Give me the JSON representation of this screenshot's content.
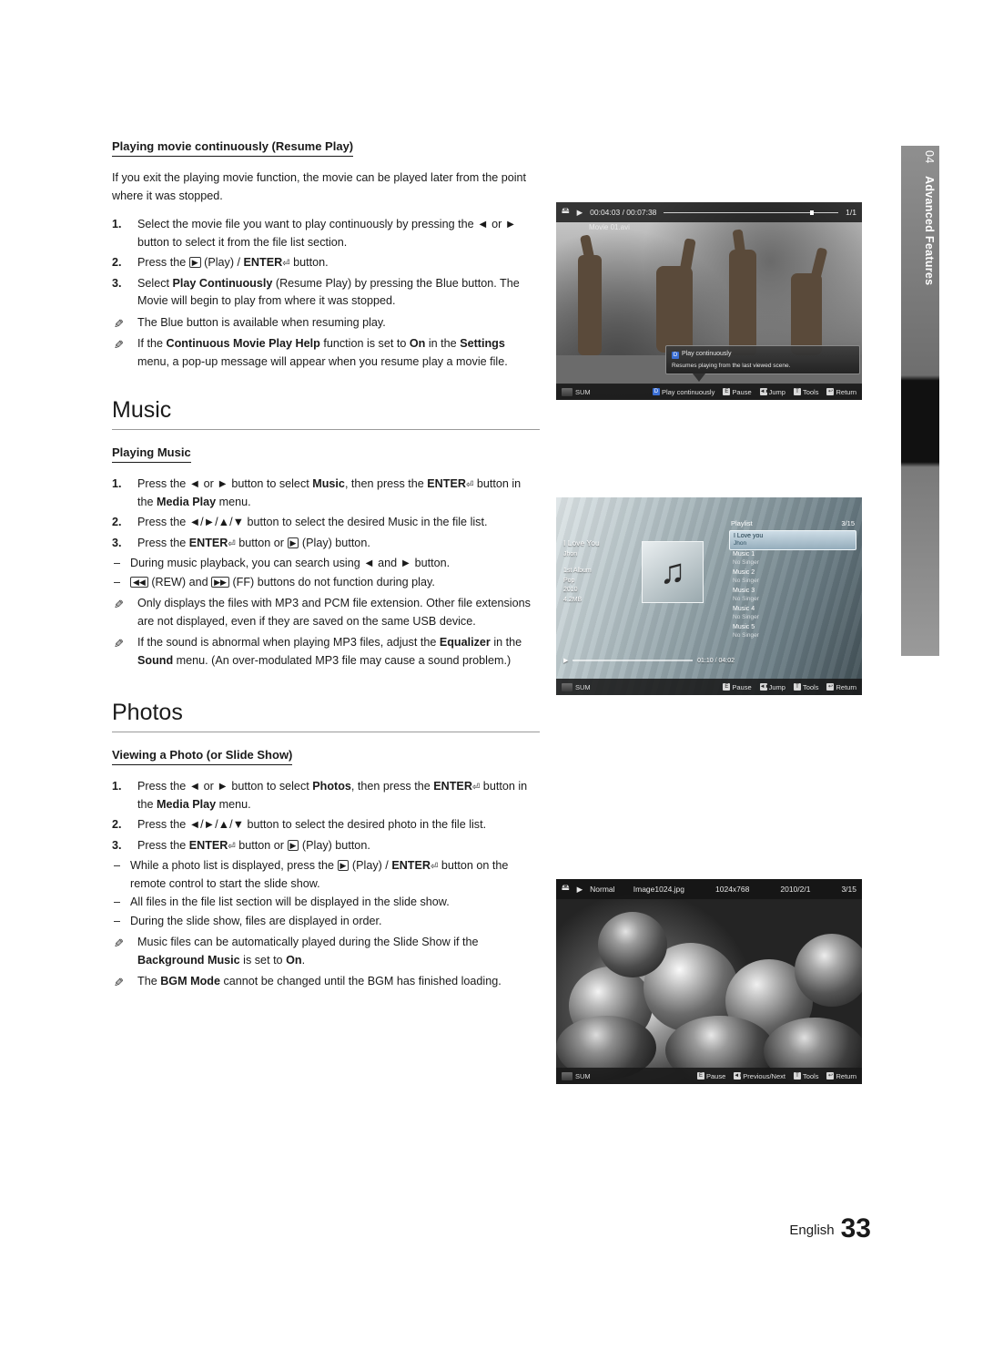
{
  "side_tab": {
    "number": "04",
    "title": "Advanced Features"
  },
  "sections": {
    "resume_play": {
      "heading": "Playing movie continuously (Resume Play)",
      "intro": "If you exit the playing movie function, the movie can be played later from the point where it was stopped.",
      "steps": [
        {
          "num": "1.",
          "text_a": "Select the movie file you want to play continuously by pressing the ",
          "text_b": " or ",
          "text_c": " button to select it from the file list section."
        },
        {
          "num": "2.",
          "text": "Press the  (Play) / ENTER button."
        },
        {
          "num": "3.",
          "text": "Select Play Continuously (Resume Play) by pressing the Blue button. The Movie will begin to play from where it was stopped."
        }
      ],
      "notes": [
        "The Blue button is available when resuming play.",
        "If the Continuous Movie Play Help function is set to On in the Settings menu, a pop-up message will appear when you resume play a movie file."
      ]
    },
    "music": {
      "chapter": "Music",
      "heading": "Playing Music",
      "steps": [
        {
          "num": "1.",
          "text": "Press the ◄ or ► button to select Music, then press the ENTER button in the Media Play menu."
        },
        {
          "num": "2.",
          "text": "Press the ◄/►/▲/▼ button to select the desired Music in the file list."
        },
        {
          "num": "3.",
          "text": "Press the ENTER button or  (Play) button."
        }
      ],
      "dashes": [
        "During music playback, you can search using ◄ and ► button.",
        "(REW) and (FF) buttons do not function during play."
      ],
      "notes": [
        "Only displays the files with MP3 and PCM file extension. Other file extensions are not displayed, even if they are saved on the same USB device.",
        "If the sound is abnormal when playing MP3 files, adjust the Equalizer in the Sound menu. (An over-modulated MP3 file may cause a sound problem.)"
      ]
    },
    "photos": {
      "chapter": "Photos",
      "heading": "Viewing a Photo (or Slide Show)",
      "steps": [
        {
          "num": "1.",
          "text": "Press the ◄ or ► button to select Photos, then press the ENTER button in the Media Play menu."
        },
        {
          "num": "2.",
          "text": "Press the ◄/►/▲/▼ button to select the desired photo in the file list."
        },
        {
          "num": "3.",
          "text": "Press the ENTER button or  (Play) button."
        }
      ],
      "dashes": [
        "While a photo list is displayed, press the  (Play) / ENTER button on the remote control to start the slide show.",
        "All files in the file list section will be displayed in the slide show.",
        "During the slide show, files are displayed in order."
      ],
      "notes": [
        "Music files can be automatically played during the Slide Show if the Background Music is set to On.",
        "The BGM Mode cannot be changed until the BGM has finished loading."
      ]
    }
  },
  "screens": {
    "movie": {
      "time": "00:04:03 / 00:07:38",
      "index": "1/1",
      "filename": "Movie 01.avi",
      "popup_title": "Play continuously",
      "popup_body": "Resumes playing from the last viewed scene.",
      "popup_key": "D",
      "source": "SUM",
      "controls": [
        {
          "key": "D",
          "label": "Play continuously"
        },
        {
          "key": "E",
          "label": "Pause"
        },
        {
          "key": "◄►",
          "label": "Jump"
        },
        {
          "key": "T",
          "label": "Tools"
        },
        {
          "key": "↩",
          "label": "Return"
        }
      ]
    },
    "music": {
      "playlist_title": "Playlist",
      "playlist_index": "3/15",
      "now_playing_title": "I Love You",
      "now_playing_artist": "Jhon",
      "meta": [
        "1st Album",
        "Pop",
        "2010",
        "4.2MB"
      ],
      "time": "01:10 / 04:02",
      "tracks": [
        {
          "title": "I Love you",
          "artist": "Jhon",
          "selected": true
        },
        {
          "title": "Music 1",
          "artist": "No Singer",
          "selected": false
        },
        {
          "title": "Music 2",
          "artist": "No Singer",
          "selected": false
        },
        {
          "title": "Music 3",
          "artist": "No Singer",
          "selected": false
        },
        {
          "title": "Music 4",
          "artist": "No Singer",
          "selected": false
        },
        {
          "title": "Music 5",
          "artist": "No Singer",
          "selected": false
        }
      ],
      "source": "SUM",
      "controls": [
        {
          "key": "E",
          "label": "Pause"
        },
        {
          "key": "◄►",
          "label": "Jump"
        },
        {
          "key": "T",
          "label": "Tools"
        },
        {
          "key": "↩",
          "label": "Return"
        }
      ]
    },
    "photo": {
      "mode": "Normal",
      "filename": "Image1024.jpg",
      "resolution": "1024x768",
      "date": "2010/2/1",
      "index": "3/15",
      "source": "SUM",
      "controls": [
        {
          "key": "E",
          "label": "Pause"
        },
        {
          "key": "◄►",
          "label": "Previous/Next"
        },
        {
          "key": "T",
          "label": "Tools"
        },
        {
          "key": "↩",
          "label": "Return"
        }
      ]
    }
  },
  "footer": {
    "language": "English",
    "page": "33"
  }
}
